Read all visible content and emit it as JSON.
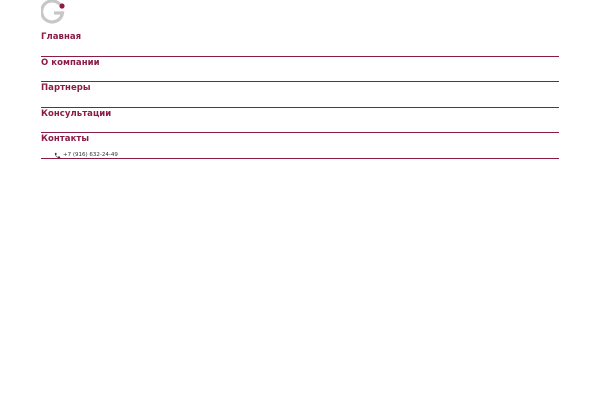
{
  "brand": {
    "logo_icon": "g-dot-logo-icon",
    "colors": {
      "accent": "#8b1c46",
      "logo_grey": "#c7c7c7",
      "text": "#333333",
      "background": "#ffffff"
    }
  },
  "nav": {
    "items": [
      {
        "label": "Главная"
      },
      {
        "label": "О компании"
      },
      {
        "label": "Партнеры"
      },
      {
        "label": "Консультации"
      },
      {
        "label": "Контакты"
      }
    ]
  },
  "contact": {
    "icon": "phone-icon",
    "phone": "+7 (916) 632-24-49"
  }
}
